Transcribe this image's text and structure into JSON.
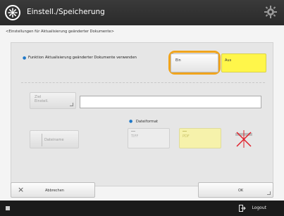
{
  "titlebar": {
    "title": "Einstell./Speicherung",
    "icon": "settings-wheel-icon",
    "right_icon": "gear-icon"
  },
  "breadcrumb": "<Einstellungen für Aktualisierung geänderter Dokumente>",
  "function_row": {
    "label": "Funktion Aktualisierung geänderter Dokumente verwenden",
    "on_label": "Ein",
    "off_label": "Aus",
    "selected": "Aus",
    "focused": "Ein"
  },
  "destination": {
    "button_label": "Ziel\nEinstell.",
    "input_value": ""
  },
  "file_format": {
    "label": "Dateiformat",
    "options": [
      "TIFF",
      "PDF"
    ],
    "selected": "PDF",
    "extra_icon": "format-disabled-icon"
  },
  "file_name_button": "Dateiname",
  "footer": {
    "cancel_label": "Abbrechen",
    "ok_label": "OK"
  },
  "statusbar": {
    "logout_label": "Logout"
  },
  "colors": {
    "selected": "#fff64a",
    "focus": "#f0a41c",
    "bullet": "#1e78c8"
  }
}
